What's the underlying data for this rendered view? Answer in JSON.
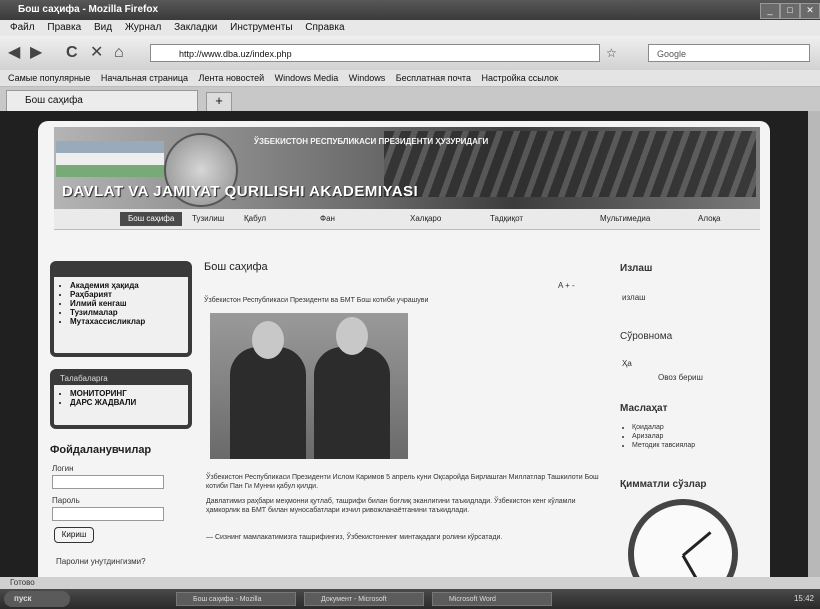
{
  "window": {
    "title": "Бош саҳифа - Mozilla Firefox"
  },
  "menu": [
    "Файл",
    "Правка",
    "Вид",
    "Журнал",
    "Закладки",
    "Инструменты",
    "Справка"
  ],
  "address": {
    "url": "http://www.dba.uz/index.php",
    "search_placeholder": "Google"
  },
  "bookmarks": [
    "Самые популярные",
    "Начальная страница",
    "Лента новостей",
    "Windows Media",
    "Windows",
    "Бесплатная почта",
    "Настройка ссылок"
  ],
  "tab": {
    "label": "Бош саҳифа",
    "new_tab": "+"
  },
  "site": {
    "headline": "ЎЗБЕКИСТОН РЕСПУБЛИКАСИ ПРЕЗИДЕНТИ ҲУЗУРИДАГИ",
    "academy": "DAVLAT VA JAMIYAT QURILISHI AKADEMIYASI",
    "nav": [
      "Бош саҳифа",
      "Тузилиш",
      "Қабул",
      "Фан",
      "Халқаро",
      "Тадқиқот",
      "Мультимедиа",
      "Алоқа"
    ]
  },
  "left": {
    "menu_items": [
      "Академия ҳақида",
      "Раҳбарият",
      "Илмий кенгаш",
      "Тузилмалар",
      "Мутахассисликлар"
    ],
    "box2_title": "Талабаларга",
    "box2_items": [
      "МОНИТОРИНГ",
      "ДАРС ЖАДВАЛИ"
    ],
    "login": {
      "title": "Фойдаланувчилар",
      "user_label": "Логин",
      "pass_label": "Пароль",
      "button": "Кириш",
      "link": "Паролни унутдингизми?"
    }
  },
  "main": {
    "title": "Бош саҳифа",
    "font_ctrl": "A  +  -",
    "caption": "Ўзбекистон Республикаси Президенти ва БМТ Бош котиби учрашуви",
    "para1": "Ўзбекистон Республикаси Президенти Ислом Каримов 5 апрель куни Оқсаройда Бирлашган Миллатлар Ташкилоти Бош котиби Пан Ги Мунни қабул қилди.",
    "para2": "Давлатимиз раҳбари меҳмонни қутлаб, ташрифи билан боғлиқ эканлигини таъкидлади. Ўзбекистон кенг кўламли ҳамкорлик ва БМТ билан муносабатлари изчил ривожланаётганини таъкидлади.",
    "para3": "— Сизнинг мамлакатимизга ташрифингиз, Ўзбекистоннинг минтақадаги ролини кўрсатади."
  },
  "right": {
    "search_title": "Излаш",
    "search_value": "излаш",
    "poll_title": "Сўровнома",
    "poll_option": "Ҳа",
    "poll_button": "Овоз бериш",
    "consult_title": "Маслаҳат",
    "consult_items": [
      "Қоидалар",
      "Аризалар",
      "Методик тавсиялар"
    ],
    "values_title": "Қимматли сўзлар"
  },
  "status": {
    "text": "Готово"
  },
  "taskbar": {
    "start": "пуск",
    "tasks": [
      "Бош саҳифа - Mozilla",
      "Документ - Microsoft",
      "Microsoft Word"
    ],
    "time": "15:42"
  }
}
